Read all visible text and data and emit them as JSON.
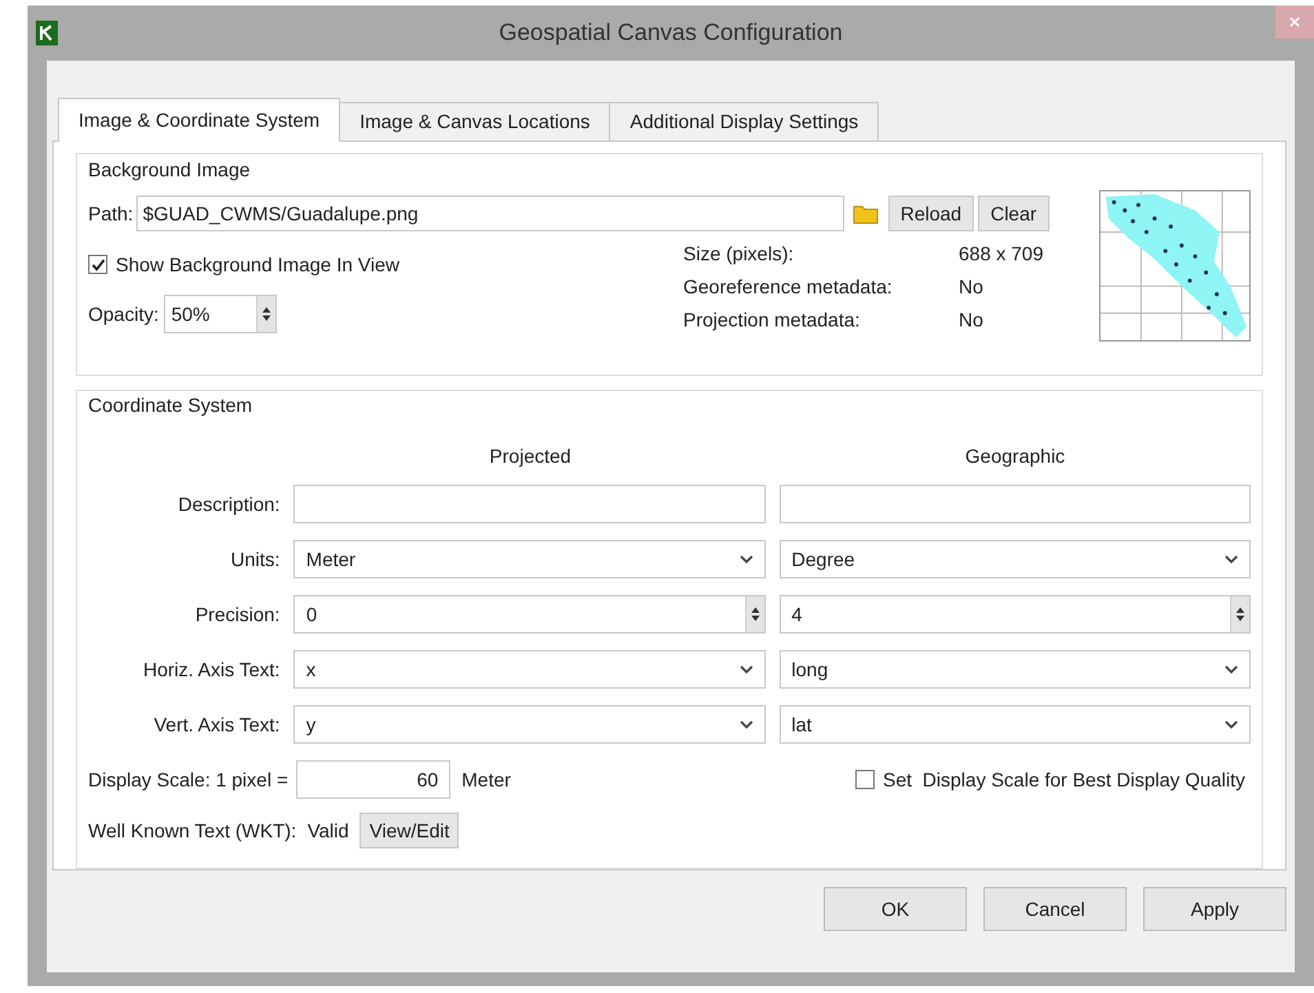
{
  "window": {
    "title": "Geospatial Canvas Configuration"
  },
  "tabs": [
    {
      "label": "Image & Coordinate System",
      "selected": true
    },
    {
      "label": "Image & Canvas Locations",
      "selected": false
    },
    {
      "label": "Additional Display Settings",
      "selected": false
    }
  ],
  "background_image": {
    "title": "Background Image",
    "path_label": "Path:",
    "path_value": "$GUAD_CWMS/Guadalupe.png",
    "reload": "Reload",
    "clear": "Clear",
    "show_in_view": {
      "label": "Show Background Image In View",
      "checked": true
    },
    "opacity_label": "Opacity:",
    "opacity_value": "50%",
    "info": [
      {
        "label": "Size (pixels):",
        "value": "688 x 709"
      },
      {
        "label": "Georeference metadata:",
        "value": "No"
      },
      {
        "label": "Projection metadata:",
        "value": "No"
      }
    ]
  },
  "coordinate_system": {
    "title": "Coordinate System",
    "columns": [
      "Projected",
      "Geographic"
    ],
    "rows": [
      {
        "label": "Description:",
        "kind": "text",
        "projected": "",
        "geographic": ""
      },
      {
        "label": "Units:",
        "kind": "combo",
        "projected": "Meter",
        "geographic": "Degree"
      },
      {
        "label": "Precision:",
        "kind": "spin",
        "projected": "0",
        "geographic": "4"
      },
      {
        "label": "Horiz. Axis Text:",
        "kind": "combo",
        "projected": "x",
        "geographic": "long"
      },
      {
        "label": "Vert. Axis Text:",
        "kind": "combo",
        "projected": "y",
        "geographic": "lat"
      }
    ],
    "display_scale_label": "Display Scale: 1 pixel =",
    "display_scale_value": "60",
    "display_scale_unit": "Meter",
    "best_quality": {
      "label": "Set  Display Scale for Best Display Quality",
      "checked": false
    },
    "wkt_label": "Well Known Text (WKT):",
    "wkt_status": "Valid",
    "wkt_button": "View/Edit"
  },
  "buttons": [
    "OK",
    "Cancel",
    "Apply"
  ]
}
